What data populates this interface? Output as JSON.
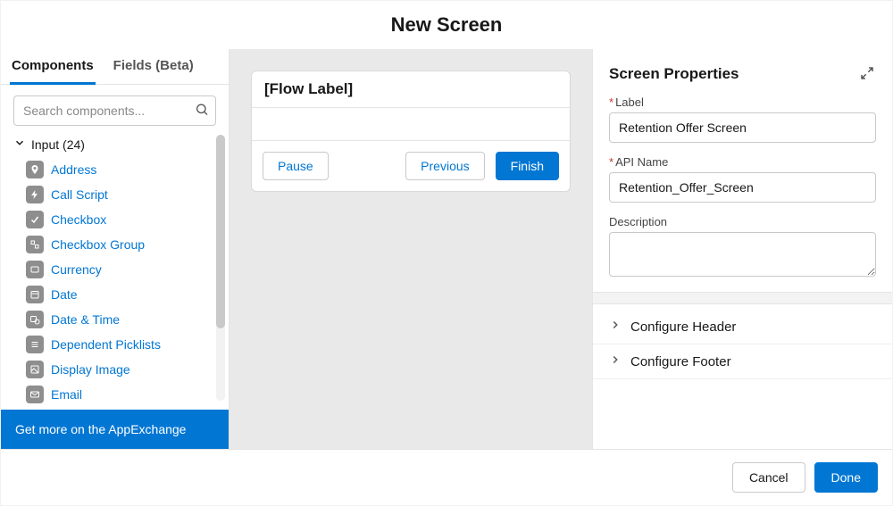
{
  "title": "New Screen",
  "left": {
    "tabs": {
      "components": "Components",
      "fields": "Fields (Beta)"
    },
    "search_placeholder": "Search components...",
    "section_label": "Input (24)",
    "items": [
      {
        "label": "Address"
      },
      {
        "label": "Call Script"
      },
      {
        "label": "Checkbox"
      },
      {
        "label": "Checkbox Group"
      },
      {
        "label": "Currency"
      },
      {
        "label": "Date"
      },
      {
        "label": "Date & Time"
      },
      {
        "label": "Dependent Picklists"
      },
      {
        "label": "Display Image"
      },
      {
        "label": "Email"
      }
    ],
    "appexchange": "Get more on the AppExchange"
  },
  "preview": {
    "flow_label": "[Flow Label]",
    "pause": "Pause",
    "previous": "Previous",
    "finish": "Finish"
  },
  "properties": {
    "title": "Screen Properties",
    "label_field": "Label",
    "label_value": "Retention Offer Screen",
    "api_name_field": "API Name",
    "api_name_value": "Retention_Offer_Screen",
    "description_field": "Description",
    "description_value": "",
    "configure_header": "Configure Header",
    "configure_footer": "Configure Footer"
  },
  "footer": {
    "cancel": "Cancel",
    "done": "Done"
  }
}
